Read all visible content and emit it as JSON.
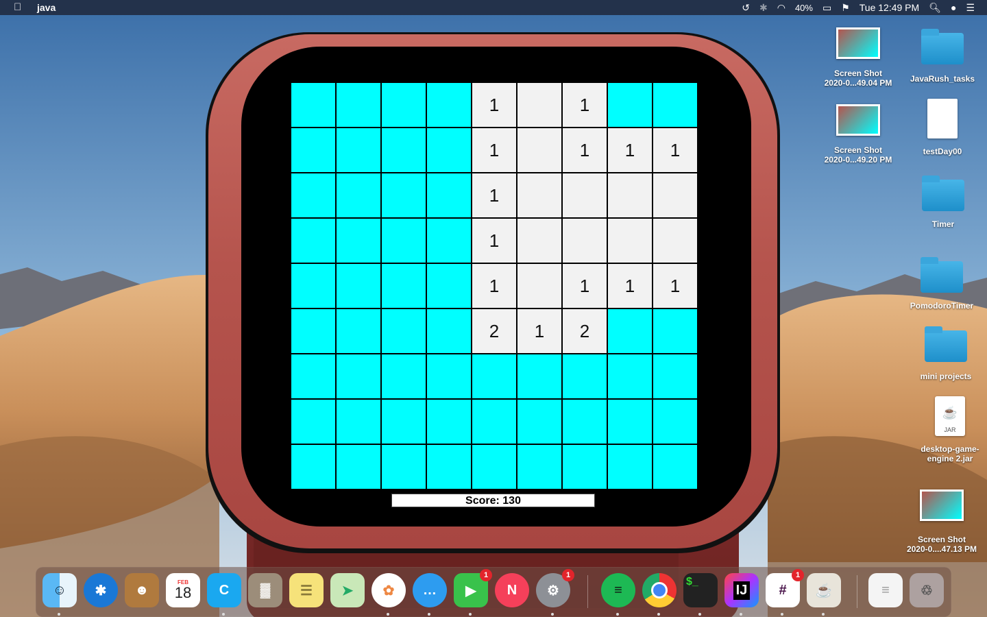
{
  "menubar": {
    "app_name": "java",
    "battery": "40%",
    "clock": "Tue 12:49 PM"
  },
  "game": {
    "score_text": "Score: 130",
    "rows": [
      [
        "",
        "",
        "",
        "",
        "1",
        "",
        "1",
        "",
        ""
      ],
      [
        "",
        "",
        "",
        "",
        "1",
        "",
        "1",
        "1",
        "1"
      ],
      [
        "",
        "",
        "",
        "",
        "1",
        "",
        "",
        "",
        ""
      ],
      [
        "",
        "",
        "",
        "",
        "1",
        "",
        "",
        "",
        ""
      ],
      [
        "",
        "",
        "",
        "",
        "1",
        "",
        "1",
        "1",
        "1"
      ],
      [
        "",
        "",
        "",
        "",
        "2",
        "1",
        "2",
        "",
        ""
      ],
      [
        "",
        "",
        "",
        "",
        "",
        "",
        "",
        "",
        ""
      ],
      [
        "",
        "",
        "",
        "",
        "",
        "",
        "",
        "",
        ""
      ],
      [
        "",
        "",
        "",
        "",
        "",
        "",
        "",
        "",
        ""
      ]
    ],
    "states": [
      [
        "c",
        "c",
        "c",
        "c",
        "o",
        "o",
        "o",
        "c",
        "c"
      ],
      [
        "c",
        "c",
        "c",
        "c",
        "o",
        "o",
        "o",
        "o",
        "o"
      ],
      [
        "c",
        "c",
        "c",
        "c",
        "o",
        "o",
        "o",
        "o",
        "o"
      ],
      [
        "c",
        "c",
        "c",
        "c",
        "o",
        "o",
        "o",
        "o",
        "o"
      ],
      [
        "c",
        "c",
        "c",
        "c",
        "o",
        "o",
        "o",
        "o",
        "o"
      ],
      [
        "c",
        "c",
        "c",
        "c",
        "o",
        "o",
        "o",
        "c",
        "c"
      ],
      [
        "c",
        "c",
        "c",
        "c",
        "c",
        "c",
        "c",
        "c",
        "c"
      ],
      [
        "c",
        "c",
        "c",
        "c",
        "c",
        "c",
        "c",
        "c",
        "c"
      ],
      [
        "c",
        "c",
        "c",
        "c",
        "c",
        "c",
        "c",
        "c",
        "c"
      ]
    ],
    "closed_color": "#00ffff",
    "open_color": "#f2f2f2"
  },
  "desktop_icons": [
    {
      "label1": "Screen Shot",
      "label2": "2020-0...49.04 PM",
      "kind": "screenshot"
    },
    {
      "label1": "JavaRush_tasks",
      "label2": "",
      "kind": "folder"
    },
    {
      "label1": "Screen Shot",
      "label2": "2020-0...49.20 PM",
      "kind": "screenshot"
    },
    {
      "label1": "testDay00",
      "label2": "",
      "kind": "document"
    },
    {
      "label1": "Timer",
      "label2": "",
      "kind": "folder"
    },
    {
      "label1": "PomodoroTimer",
      "label2": "",
      "kind": "folder"
    },
    {
      "label1": "mini projects",
      "label2": "",
      "kind": "folder"
    },
    {
      "label1": "desktop-game-",
      "label2": "engine 2.jar",
      "kind": "jar"
    },
    {
      "label1": "Screen Shot",
      "label2": "2020-0....47.13 PM",
      "kind": "screenshot"
    }
  ],
  "jar_label": "JAR",
  "calendar": {
    "month": "FEB",
    "day": "18"
  },
  "dock": {
    "badges": [
      "1",
      "1",
      "1"
    ]
  },
  "colors": {
    "menubar": "#23324b",
    "bezel": "#b5544d",
    "sky_top": "#3a6ea8",
    "dune": "#c98f5a"
  }
}
